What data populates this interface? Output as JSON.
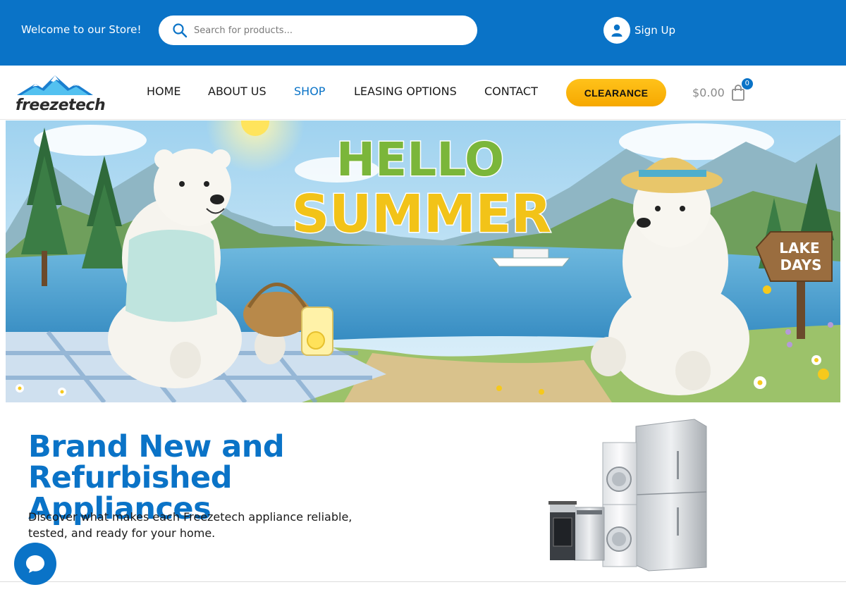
{
  "topbar": {
    "welcome_text": "Welcome to our Store!",
    "search_placeholder": "Search for products...",
    "signup_label": "Sign Up"
  },
  "nav": {
    "logo_text": "freezetech",
    "items": [
      {
        "label": "HOME",
        "active": false
      },
      {
        "label": "ABOUT US",
        "active": false
      },
      {
        "label": "SHOP",
        "active": true
      },
      {
        "label": "LEASING OPTIONS",
        "active": false
      },
      {
        "label": "CONTACT",
        "active": false
      }
    ],
    "clearance_label": "CLEARANCE",
    "cart_amount": "$0.00",
    "cart_count": "0"
  },
  "hero": {
    "headline_line1": "HELLO",
    "headline_line2": "SUMMER",
    "sign_line1": "LAKE",
    "sign_line2": "DAYS"
  },
  "intro": {
    "title_line1": "Brand New and",
    "title_line2": "Refurbished Appliances",
    "description": "Discover what makes each Freezetech appliance reliable, tested, and ready for your home."
  },
  "icons": {
    "search": "search-icon",
    "user": "user-icon",
    "cart": "shopping-bag-icon",
    "chat": "chat-bubble-icon"
  },
  "colors": {
    "brand_blue": "#0a73c7",
    "clearance_yellow": "#ffc21a",
    "text_dark": "#1a1a1a"
  }
}
